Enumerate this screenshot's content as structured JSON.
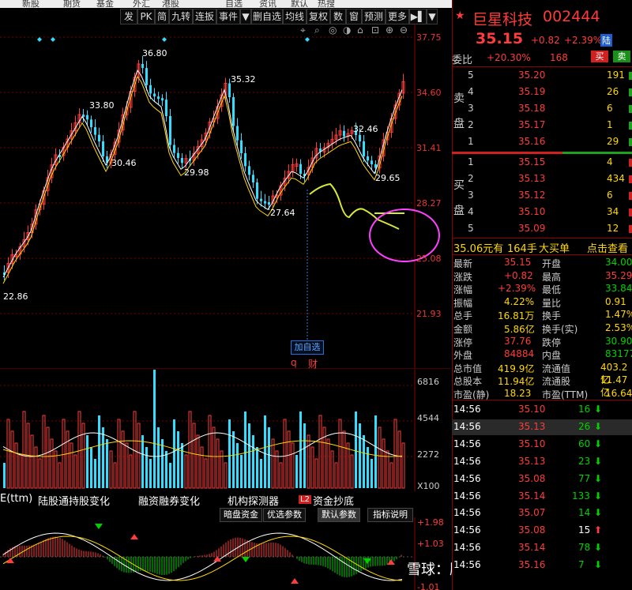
{
  "top_menu": [
    "新股",
    "期货",
    "基金",
    "外汇",
    "港股",
    "自选",
    "资讯",
    "默认",
    "热搜"
  ],
  "toolbar": [
    {
      "label": "发",
      "w": 20
    },
    {
      "label": "PK",
      "w": 20
    },
    {
      "label": "简",
      "w": 16
    },
    {
      "label": "九转",
      "w": 28
    },
    {
      "label": "连扳",
      "w": 28
    },
    {
      "label": "事件",
      "w": 28
    },
    {
      "label": "▼",
      "w": 12
    },
    {
      "label": "删自选",
      "w": 38
    },
    {
      "label": "均线",
      "w": 28
    },
    {
      "label": "复权",
      "w": 28
    },
    {
      "label": "数",
      "w": 18
    },
    {
      "label": "窗",
      "w": 18
    },
    {
      "label": "预测",
      "w": 28
    },
    {
      "label": "更多",
      "w": 28
    },
    {
      "label": "▶▌",
      "w": 20
    },
    {
      "label": "▼",
      "w": 12
    }
  ],
  "y_axis_price": [
    "37.75",
    "34.60",
    "31.41",
    "28.27",
    "25.08",
    "21.93"
  ],
  "y_axis_volume": [
    "6816",
    "4544",
    "2272",
    "X100"
  ],
  "price_labels": [
    {
      "text": "36.80"
    },
    {
      "text": "35.32"
    },
    {
      "text": "33.80"
    },
    {
      "text": "32.46"
    },
    {
      "text": "30.46"
    },
    {
      "text": "29.98"
    },
    {
      "text": "29.65"
    },
    {
      "text": "27.64"
    },
    {
      "text": "22.86"
    }
  ],
  "add_watch_label": "加自选",
  "marker_q": "q",
  "marker_cai": "财",
  "tabs": [
    "E(ttm)",
    "陆股通持股变化",
    "融资融券变化",
    "机构探测器",
    "L2",
    "资金抄底"
  ],
  "indicator_buttons": [
    "暗盘资金",
    "优选参数",
    "默认参数",
    "指标说明"
  ],
  "macd_axis": [
    "1.98",
    "1.03",
    "-1.01"
  ],
  "watermark": "雪球：股民肖久财二世",
  "stock": {
    "name": "巨星科技",
    "code": "002444",
    "price": "35.15",
    "change": "+0.82",
    "change_pct": "+2.39%",
    "tag": "陆",
    "weibi_label": "委比",
    "weibi": "+20.30%",
    "weicha": "168",
    "buy_btn": "买",
    "sell_btn": "卖"
  },
  "asks": [
    {
      "lvl": "5",
      "price": "35.20",
      "vol": "191"
    },
    {
      "lvl": "4",
      "price": "35.19",
      "vol": "26"
    },
    {
      "lvl": "3",
      "price": "35.18",
      "vol": "6"
    },
    {
      "lvl": "2",
      "price": "35.17",
      "vol": "1"
    },
    {
      "lvl": "1",
      "price": "35.16",
      "vol": "29"
    }
  ],
  "bids": [
    {
      "lvl": "1",
      "price": "35.15",
      "vol": "4"
    },
    {
      "lvl": "2",
      "price": "35.13",
      "vol": "434"
    },
    {
      "lvl": "3",
      "price": "35.12",
      "vol": "6"
    },
    {
      "lvl": "4",
      "price": "35.10",
      "vol": "34"
    },
    {
      "lvl": "5",
      "price": "35.09",
      "vol": "12"
    }
  ],
  "ask_side_label": [
    "卖",
    "盘"
  ],
  "bid_side_label": [
    "买",
    "盘"
  ],
  "big_order": {
    "text": "35.06元有",
    "qty": "164手",
    "type": "大买单",
    "link": "点击查看"
  },
  "stats": [
    {
      "k1": "最新",
      "v1": "35.15",
      "c1": "red",
      "k2": "开盘",
      "v2": "34.00",
      "c2": "grn"
    },
    {
      "k1": "涨跌",
      "v1": "+0.82",
      "c1": "red",
      "k2": "最高",
      "v2": "35.29",
      "c2": "red"
    },
    {
      "k1": "涨幅",
      "v1": "+2.39%",
      "c1": "red",
      "k2": "最低",
      "v2": "33.84",
      "c2": "grn"
    },
    {
      "k1": "振幅",
      "v1": "4.22%",
      "c1": "yel",
      "k2": "量比",
      "v2": "0.91",
      "c2": "yel"
    },
    {
      "k1": "总手",
      "v1": "16.81万",
      "c1": "yel",
      "k2": "换手",
      "v2": "1.47%",
      "c2": "yel"
    },
    {
      "k1": "金额",
      "v1": "5.86亿",
      "c1": "yel",
      "k2": "换手(实)",
      "v2": "2.53%",
      "c2": "yel"
    },
    {
      "k1": "涨停",
      "v1": "37.76",
      "c1": "red",
      "k2": "跌停",
      "v2": "30.90",
      "c2": "grn"
    },
    {
      "k1": "外盘",
      "v1": "84884",
      "c1": "red",
      "k2": "内盘",
      "v2": "83177",
      "c2": "grn"
    },
    {
      "k1": "总市值",
      "v1": "419.9亿",
      "c1": "yel",
      "k2": "流通值",
      "v2": "403.2亿",
      "c2": "yel"
    },
    {
      "k1": "总股本",
      "v1": "11.94亿",
      "c1": "yel",
      "k2": "流通股",
      "v2": "11.47亿",
      "c2": "yel"
    },
    {
      "k1": "市盈(静)",
      "v1": "18.23",
      "c1": "yel",
      "k2": "市盈(TTM)",
      "v2": "16.64",
      "c2": "yel"
    }
  ],
  "ticks": [
    {
      "t": "14:56",
      "p": "35.10",
      "v": "16",
      "d": "down"
    },
    {
      "t": "14:56",
      "p": "35.13",
      "v": "26",
      "d": "down"
    },
    {
      "t": "14:56",
      "p": "35.10",
      "v": "60",
      "d": "down"
    },
    {
      "t": "14:56",
      "p": "35.13",
      "v": "23",
      "d": "down"
    },
    {
      "t": "14:56",
      "p": "35.08",
      "v": "77",
      "d": "down"
    },
    {
      "t": "14:56",
      "p": "35.14",
      "v": "133",
      "d": "down"
    },
    {
      "t": "14:56",
      "p": "35.07",
      "v": "14",
      "d": "down"
    },
    {
      "t": "14:56",
      "p": "35.08",
      "v": "15",
      "d": "up"
    },
    {
      "t": "14:56",
      "p": "35.14",
      "v": "78",
      "d": "down"
    },
    {
      "t": "14:56",
      "p": "35.16",
      "v": "7",
      "d": "down"
    }
  ]
}
